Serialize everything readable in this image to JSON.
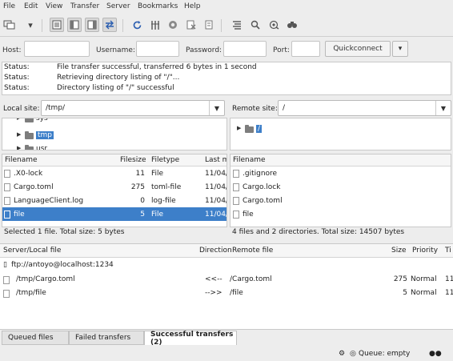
{
  "menu": [
    "File",
    "Edit",
    "View",
    "Transfer",
    "Server",
    "Bookmarks",
    "Help"
  ],
  "toolbar": {
    "icons": [
      "site-manager-icon",
      "dropdown-arrow-icon",
      "message-log-toggle-icon",
      "local-tree-toggle-icon",
      "remote-tree-toggle-icon",
      "transfer-queue-toggle-icon",
      "refresh-icon",
      "process-queue-icon",
      "cancel-operation-icon",
      "disconnect-icon",
      "reconnect-icon",
      "filter-icon",
      "search-remote-icon",
      "compare-dirs-icon",
      "find-files-icon"
    ]
  },
  "quickconnect": {
    "host_label": "Host:",
    "host_value": "",
    "username_label": "Username:",
    "username_value": "",
    "password_label": "Password:",
    "password_value": "",
    "port_label": "Port:",
    "port_value": "",
    "button_label": "Quickconnect",
    "dropdown_glyph": "▾"
  },
  "log": [
    {
      "k": "Status:",
      "v": "File transfer successful, transferred 6 bytes in 1 second"
    },
    {
      "k": "Status:",
      "v": "Retrieving directory listing of \"/\"..."
    },
    {
      "k": "Status:",
      "v": "Directory listing of \"/\" successful"
    }
  ],
  "local": {
    "site_label": "Local site:",
    "site_path": "/tmp/",
    "tree": [
      {
        "name": "sys",
        "selected": false
      },
      {
        "name": "tmp",
        "selected": true
      },
      {
        "name": "usr",
        "selected": false
      }
    ],
    "columns": [
      "Filename",
      "Filesize",
      "Filetype",
      "Last m"
    ],
    "files": [
      {
        "name": ".X0-lock",
        "size": "11",
        "type": "File",
        "date": "11/04/",
        "selected": false
      },
      {
        "name": "Cargo.toml",
        "size": "275",
        "type": "toml-file",
        "date": "11/04/",
        "selected": false
      },
      {
        "name": "LanguageClient.log",
        "size": "0",
        "type": "log-file",
        "date": "11/04/",
        "selected": false
      },
      {
        "name": "file",
        "size": "5",
        "type": "File",
        "date": "11/04/",
        "selected": true
      }
    ],
    "status": "Selected 1 file. Total size: 5 bytes"
  },
  "remote": {
    "site_label": "Remote site:",
    "site_path": "/",
    "tree": [
      {
        "name": "/",
        "selected": true
      }
    ],
    "columns": [
      "Filename"
    ],
    "files": [
      {
        "name": ".gitignore"
      },
      {
        "name": "Cargo.lock"
      },
      {
        "name": "Cargo.toml"
      },
      {
        "name": "file"
      }
    ],
    "status": "4 files and 2 directories. Total size: 14507 bytes"
  },
  "queue": {
    "columns": [
      "Server/Local file",
      "Direction",
      "Remote file",
      "Size",
      "Priority",
      "Ti"
    ],
    "server": "ftp://antoyo@localhost:1234",
    "rows": [
      {
        "local": "/tmp/Cargo.toml",
        "direction": "<<--",
        "remote": "/Cargo.toml",
        "size": "275",
        "priority": "Normal",
        "time": "11"
      },
      {
        "local": "/tmp/file",
        "direction": "-->>",
        "remote": "/file",
        "size": "5",
        "priority": "Normal",
        "time": "11"
      }
    ]
  },
  "tabs": [
    "Queued files",
    "Failed transfers",
    "Successful transfers (2)"
  ],
  "statusbar": {
    "queue_text": "Queue: empty"
  },
  "colors": {
    "selection": "#3d7fc9"
  }
}
